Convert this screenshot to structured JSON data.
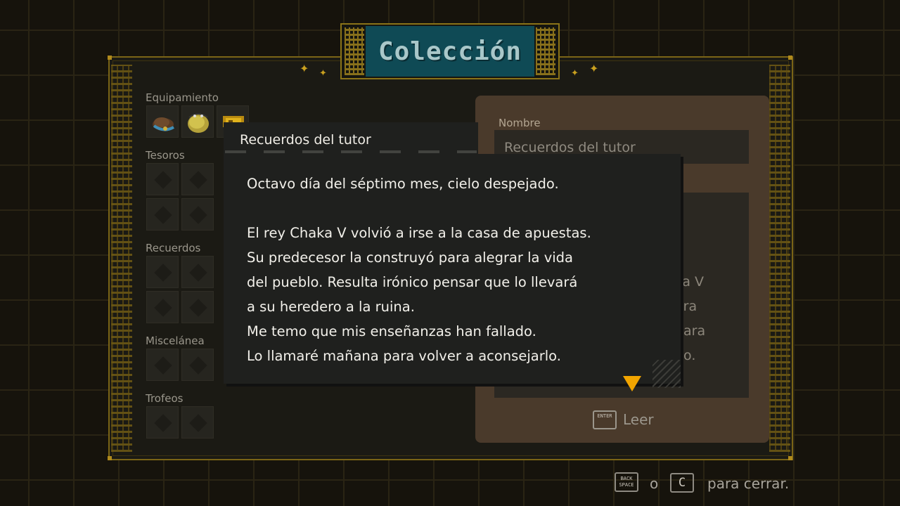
{
  "title": "Colección",
  "categories": {
    "equipment": "Equipamiento",
    "treasures": "Tesoros",
    "memories": "Recuerdos",
    "misc": "Miscelánea",
    "trophies": "Trofeos"
  },
  "equipment_icons": [
    "feather-hat-icon",
    "golden-helmet-icon",
    "golden-relic-icon"
  ],
  "detail": {
    "name_label": "Nombre",
    "name_value": "Recuerdos del tutor",
    "desc_peek": [
      ".",
      "haka V",
      "ara",
      "nara",
      "po."
    ],
    "read_key": "ENTER",
    "read_label": "Leer"
  },
  "popup": {
    "title": "Recuerdos del tutor",
    "lines": [
      "Octavo día del séptimo mes, cielo despejado.",
      "",
      "El rey Chaka V volvió a irse a la casa de apuestas.",
      "Su predecesor la construyó para alegrar la vida",
      "del pueblo. Resulta irónico pensar que lo llevará",
      "a su heredero a la ruina.",
      "Me temo que mis enseñanzas han fallado.",
      "Lo llamaré mañana para volver a aconsejarlo."
    ],
    "advance_icon": "continue-arrow-icon"
  },
  "hint": {
    "back_key_line1": "BACK",
    "back_key_line2": "SPACE",
    "or": "o",
    "c_key": "C",
    "close": "para cerrar."
  },
  "colors": {
    "frame_gold": "#7a6416",
    "title_teal": "#0f4a55",
    "detail_brown": "#4a3a2b",
    "arrow_orange": "#f2a500"
  }
}
